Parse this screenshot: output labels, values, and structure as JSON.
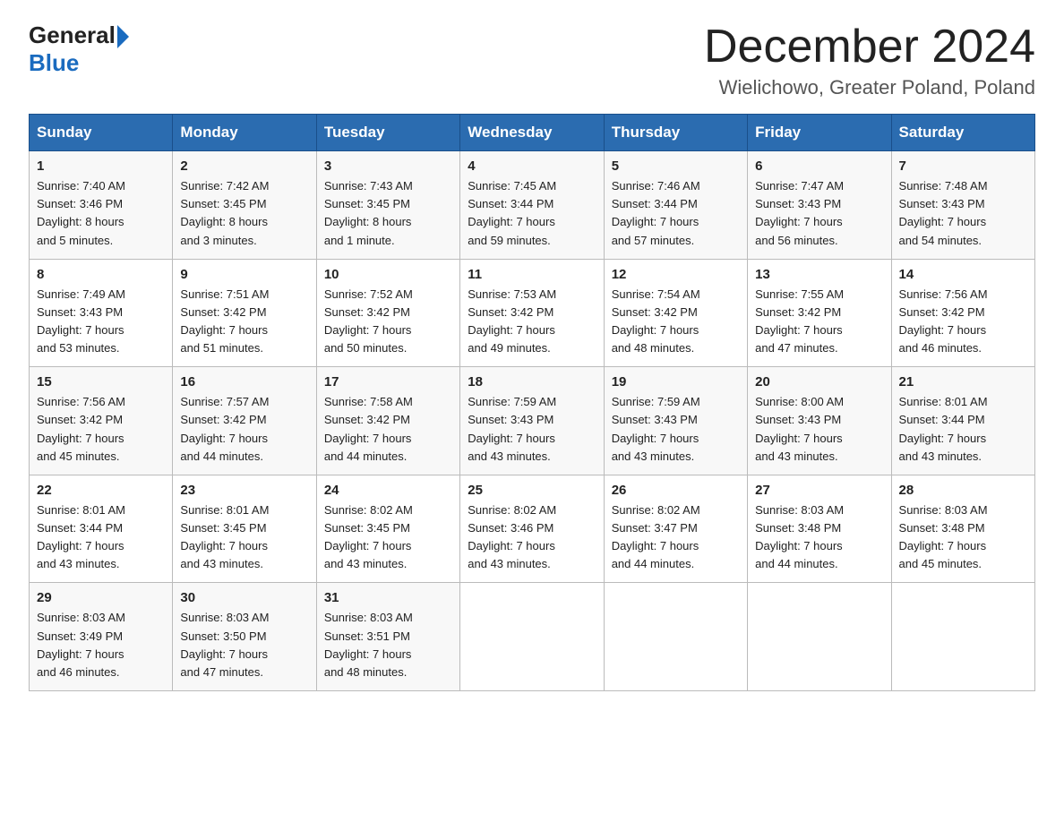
{
  "header": {
    "logo_general": "General",
    "logo_blue": "Blue",
    "month_title": "December 2024",
    "location": "Wielichowo, Greater Poland, Poland"
  },
  "days_of_week": [
    "Sunday",
    "Monday",
    "Tuesday",
    "Wednesday",
    "Thursday",
    "Friday",
    "Saturday"
  ],
  "weeks": [
    [
      {
        "day": "1",
        "sunrise": "7:40 AM",
        "sunset": "3:46 PM",
        "daylight": "8 hours and 5 minutes."
      },
      {
        "day": "2",
        "sunrise": "7:42 AM",
        "sunset": "3:45 PM",
        "daylight": "8 hours and 3 minutes."
      },
      {
        "day": "3",
        "sunrise": "7:43 AM",
        "sunset": "3:45 PM",
        "daylight": "8 hours and 1 minute."
      },
      {
        "day": "4",
        "sunrise": "7:45 AM",
        "sunset": "3:44 PM",
        "daylight": "7 hours and 59 minutes."
      },
      {
        "day": "5",
        "sunrise": "7:46 AM",
        "sunset": "3:44 PM",
        "daylight": "7 hours and 57 minutes."
      },
      {
        "day": "6",
        "sunrise": "7:47 AM",
        "sunset": "3:43 PM",
        "daylight": "7 hours and 56 minutes."
      },
      {
        "day": "7",
        "sunrise": "7:48 AM",
        "sunset": "3:43 PM",
        "daylight": "7 hours and 54 minutes."
      }
    ],
    [
      {
        "day": "8",
        "sunrise": "7:49 AM",
        "sunset": "3:43 PM",
        "daylight": "7 hours and 53 minutes."
      },
      {
        "day": "9",
        "sunrise": "7:51 AM",
        "sunset": "3:42 PM",
        "daylight": "7 hours and 51 minutes."
      },
      {
        "day": "10",
        "sunrise": "7:52 AM",
        "sunset": "3:42 PM",
        "daylight": "7 hours and 50 minutes."
      },
      {
        "day": "11",
        "sunrise": "7:53 AM",
        "sunset": "3:42 PM",
        "daylight": "7 hours and 49 minutes."
      },
      {
        "day": "12",
        "sunrise": "7:54 AM",
        "sunset": "3:42 PM",
        "daylight": "7 hours and 48 minutes."
      },
      {
        "day": "13",
        "sunrise": "7:55 AM",
        "sunset": "3:42 PM",
        "daylight": "7 hours and 47 minutes."
      },
      {
        "day": "14",
        "sunrise": "7:56 AM",
        "sunset": "3:42 PM",
        "daylight": "7 hours and 46 minutes."
      }
    ],
    [
      {
        "day": "15",
        "sunrise": "7:56 AM",
        "sunset": "3:42 PM",
        "daylight": "7 hours and 45 minutes."
      },
      {
        "day": "16",
        "sunrise": "7:57 AM",
        "sunset": "3:42 PM",
        "daylight": "7 hours and 44 minutes."
      },
      {
        "day": "17",
        "sunrise": "7:58 AM",
        "sunset": "3:42 PM",
        "daylight": "7 hours and 44 minutes."
      },
      {
        "day": "18",
        "sunrise": "7:59 AM",
        "sunset": "3:43 PM",
        "daylight": "7 hours and 43 minutes."
      },
      {
        "day": "19",
        "sunrise": "7:59 AM",
        "sunset": "3:43 PM",
        "daylight": "7 hours and 43 minutes."
      },
      {
        "day": "20",
        "sunrise": "8:00 AM",
        "sunset": "3:43 PM",
        "daylight": "7 hours and 43 minutes."
      },
      {
        "day": "21",
        "sunrise": "8:01 AM",
        "sunset": "3:44 PM",
        "daylight": "7 hours and 43 minutes."
      }
    ],
    [
      {
        "day": "22",
        "sunrise": "8:01 AM",
        "sunset": "3:44 PM",
        "daylight": "7 hours and 43 minutes."
      },
      {
        "day": "23",
        "sunrise": "8:01 AM",
        "sunset": "3:45 PM",
        "daylight": "7 hours and 43 minutes."
      },
      {
        "day": "24",
        "sunrise": "8:02 AM",
        "sunset": "3:45 PM",
        "daylight": "7 hours and 43 minutes."
      },
      {
        "day": "25",
        "sunrise": "8:02 AM",
        "sunset": "3:46 PM",
        "daylight": "7 hours and 43 minutes."
      },
      {
        "day": "26",
        "sunrise": "8:02 AM",
        "sunset": "3:47 PM",
        "daylight": "7 hours and 44 minutes."
      },
      {
        "day": "27",
        "sunrise": "8:03 AM",
        "sunset": "3:48 PM",
        "daylight": "7 hours and 44 minutes."
      },
      {
        "day": "28",
        "sunrise": "8:03 AM",
        "sunset": "3:48 PM",
        "daylight": "7 hours and 45 minutes."
      }
    ],
    [
      {
        "day": "29",
        "sunrise": "8:03 AM",
        "sunset": "3:49 PM",
        "daylight": "7 hours and 46 minutes."
      },
      {
        "day": "30",
        "sunrise": "8:03 AM",
        "sunset": "3:50 PM",
        "daylight": "7 hours and 47 minutes."
      },
      {
        "day": "31",
        "sunrise": "8:03 AM",
        "sunset": "3:51 PM",
        "daylight": "7 hours and 48 minutes."
      },
      null,
      null,
      null,
      null
    ]
  ],
  "labels": {
    "sunrise": "Sunrise: ",
    "sunset": "Sunset: ",
    "daylight": "Daylight: "
  }
}
